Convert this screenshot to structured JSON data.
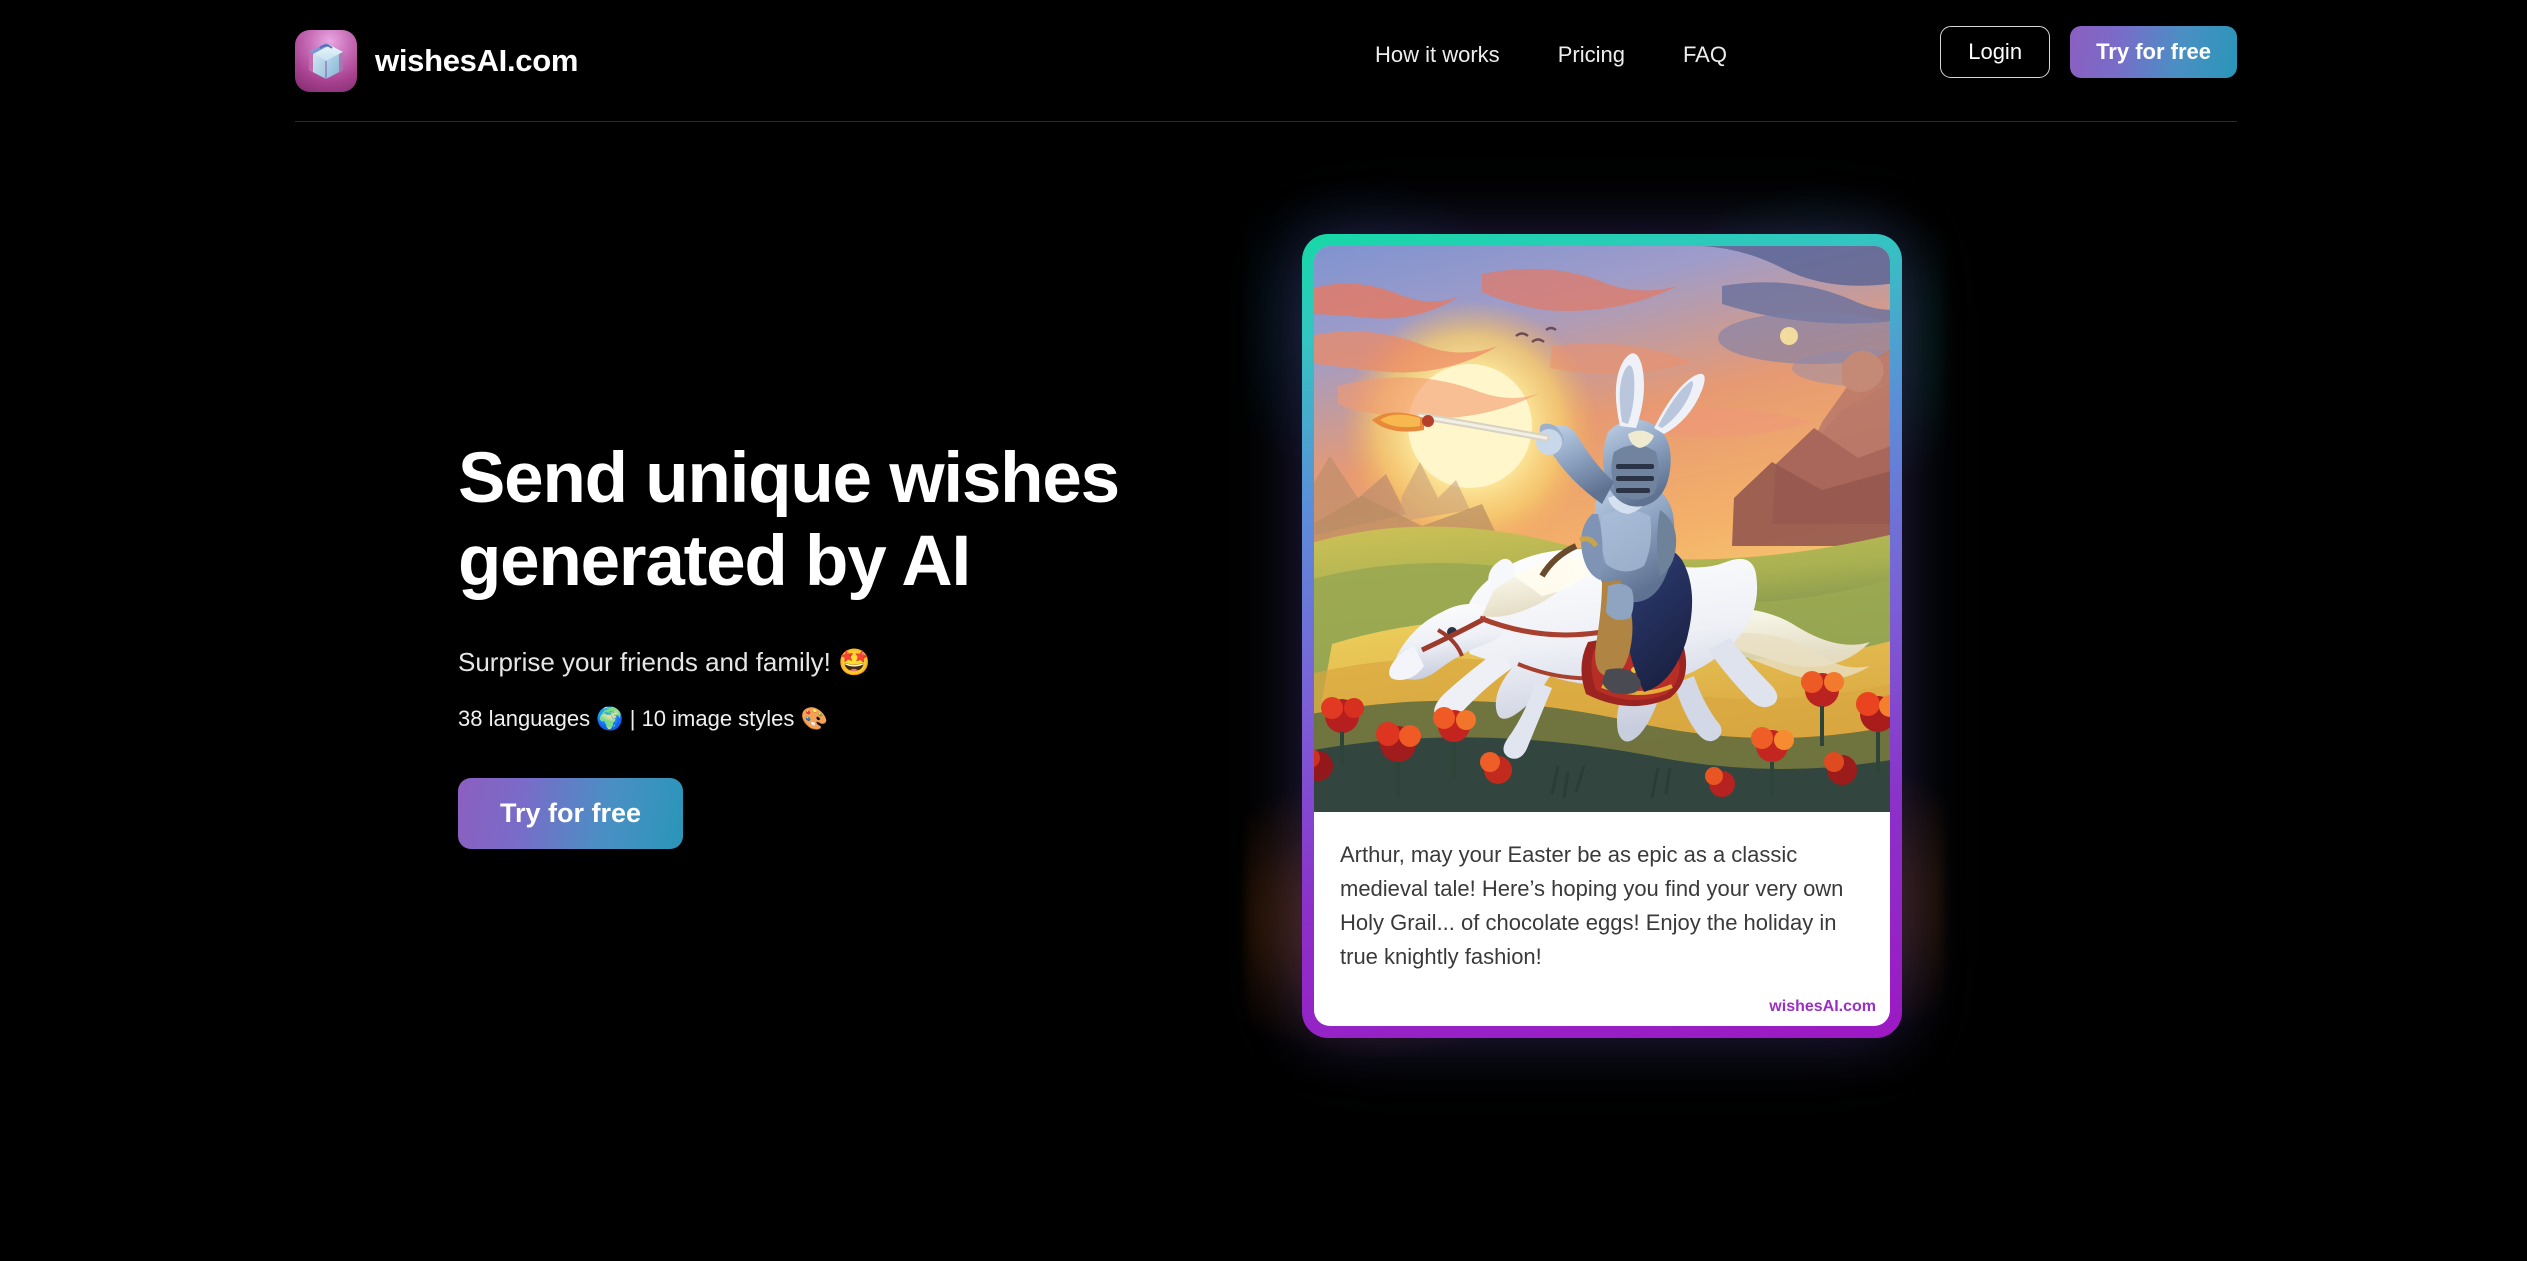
{
  "brand": {
    "name": "wishesAI.com",
    "logo_icon": "gift-box-icon"
  },
  "nav": {
    "links": [
      {
        "label": "How it works"
      },
      {
        "label": "Pricing"
      },
      {
        "label": "FAQ"
      }
    ],
    "login_label": "Login",
    "cta_label": "Try for free"
  },
  "hero": {
    "title_line1": "Send unique wishes",
    "title_line2": "generated by AI",
    "subtitle": "Surprise your friends and family!  🤩",
    "features": "38 languages 🌍 | 10 image styles 🎨",
    "cta_label": "Try for free"
  },
  "card": {
    "image_alt": "knight-on-white-horse-sunset-illustration",
    "message": "Arthur, may your Easter be as epic as a classic medieval tale! Here’s hoping you find your very own Holy Grail... of chocolate eggs! Enjoy the holiday in true knightly fashion!",
    "watermark": "wishesAI.com"
  },
  "colors": {
    "background": "#000000",
    "accent_purple": "#8b5fc0",
    "accent_teal": "#2a96b8",
    "card_border_top": "#16d9a6",
    "card_border_bottom": "#9d18c4",
    "watermark": "#9b2fc4"
  }
}
